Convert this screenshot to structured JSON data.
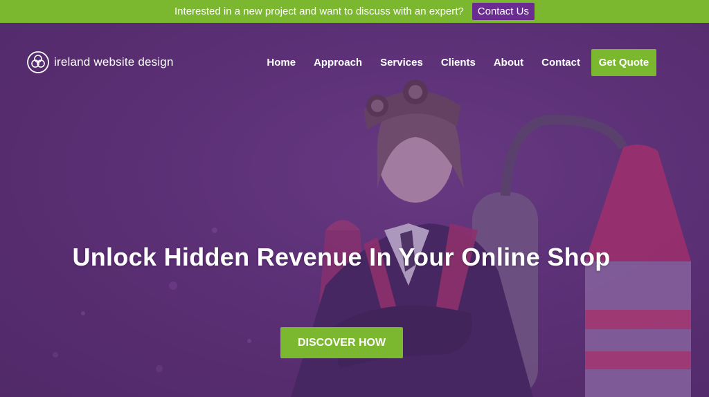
{
  "topbar": {
    "message": "Interested in a new project and want to discuss with an expert?",
    "contact_label": "Contact Us"
  },
  "header": {
    "logo_text": "ireland website design",
    "nav": [
      {
        "label": "Home"
      },
      {
        "label": "Approach"
      },
      {
        "label": "Services"
      },
      {
        "label": "Clients"
      },
      {
        "label": "About"
      },
      {
        "label": "Contact"
      }
    ],
    "quote_label": "Get Quote"
  },
  "hero": {
    "headline": "Unlock Hidden Revenue In Your Online Shop",
    "cta_label": "DISCOVER HOW"
  },
  "colors": {
    "accent_green": "#7cb82f",
    "brand_purple": "#6a2c91",
    "overlay_purple": "#5a2f73"
  }
}
